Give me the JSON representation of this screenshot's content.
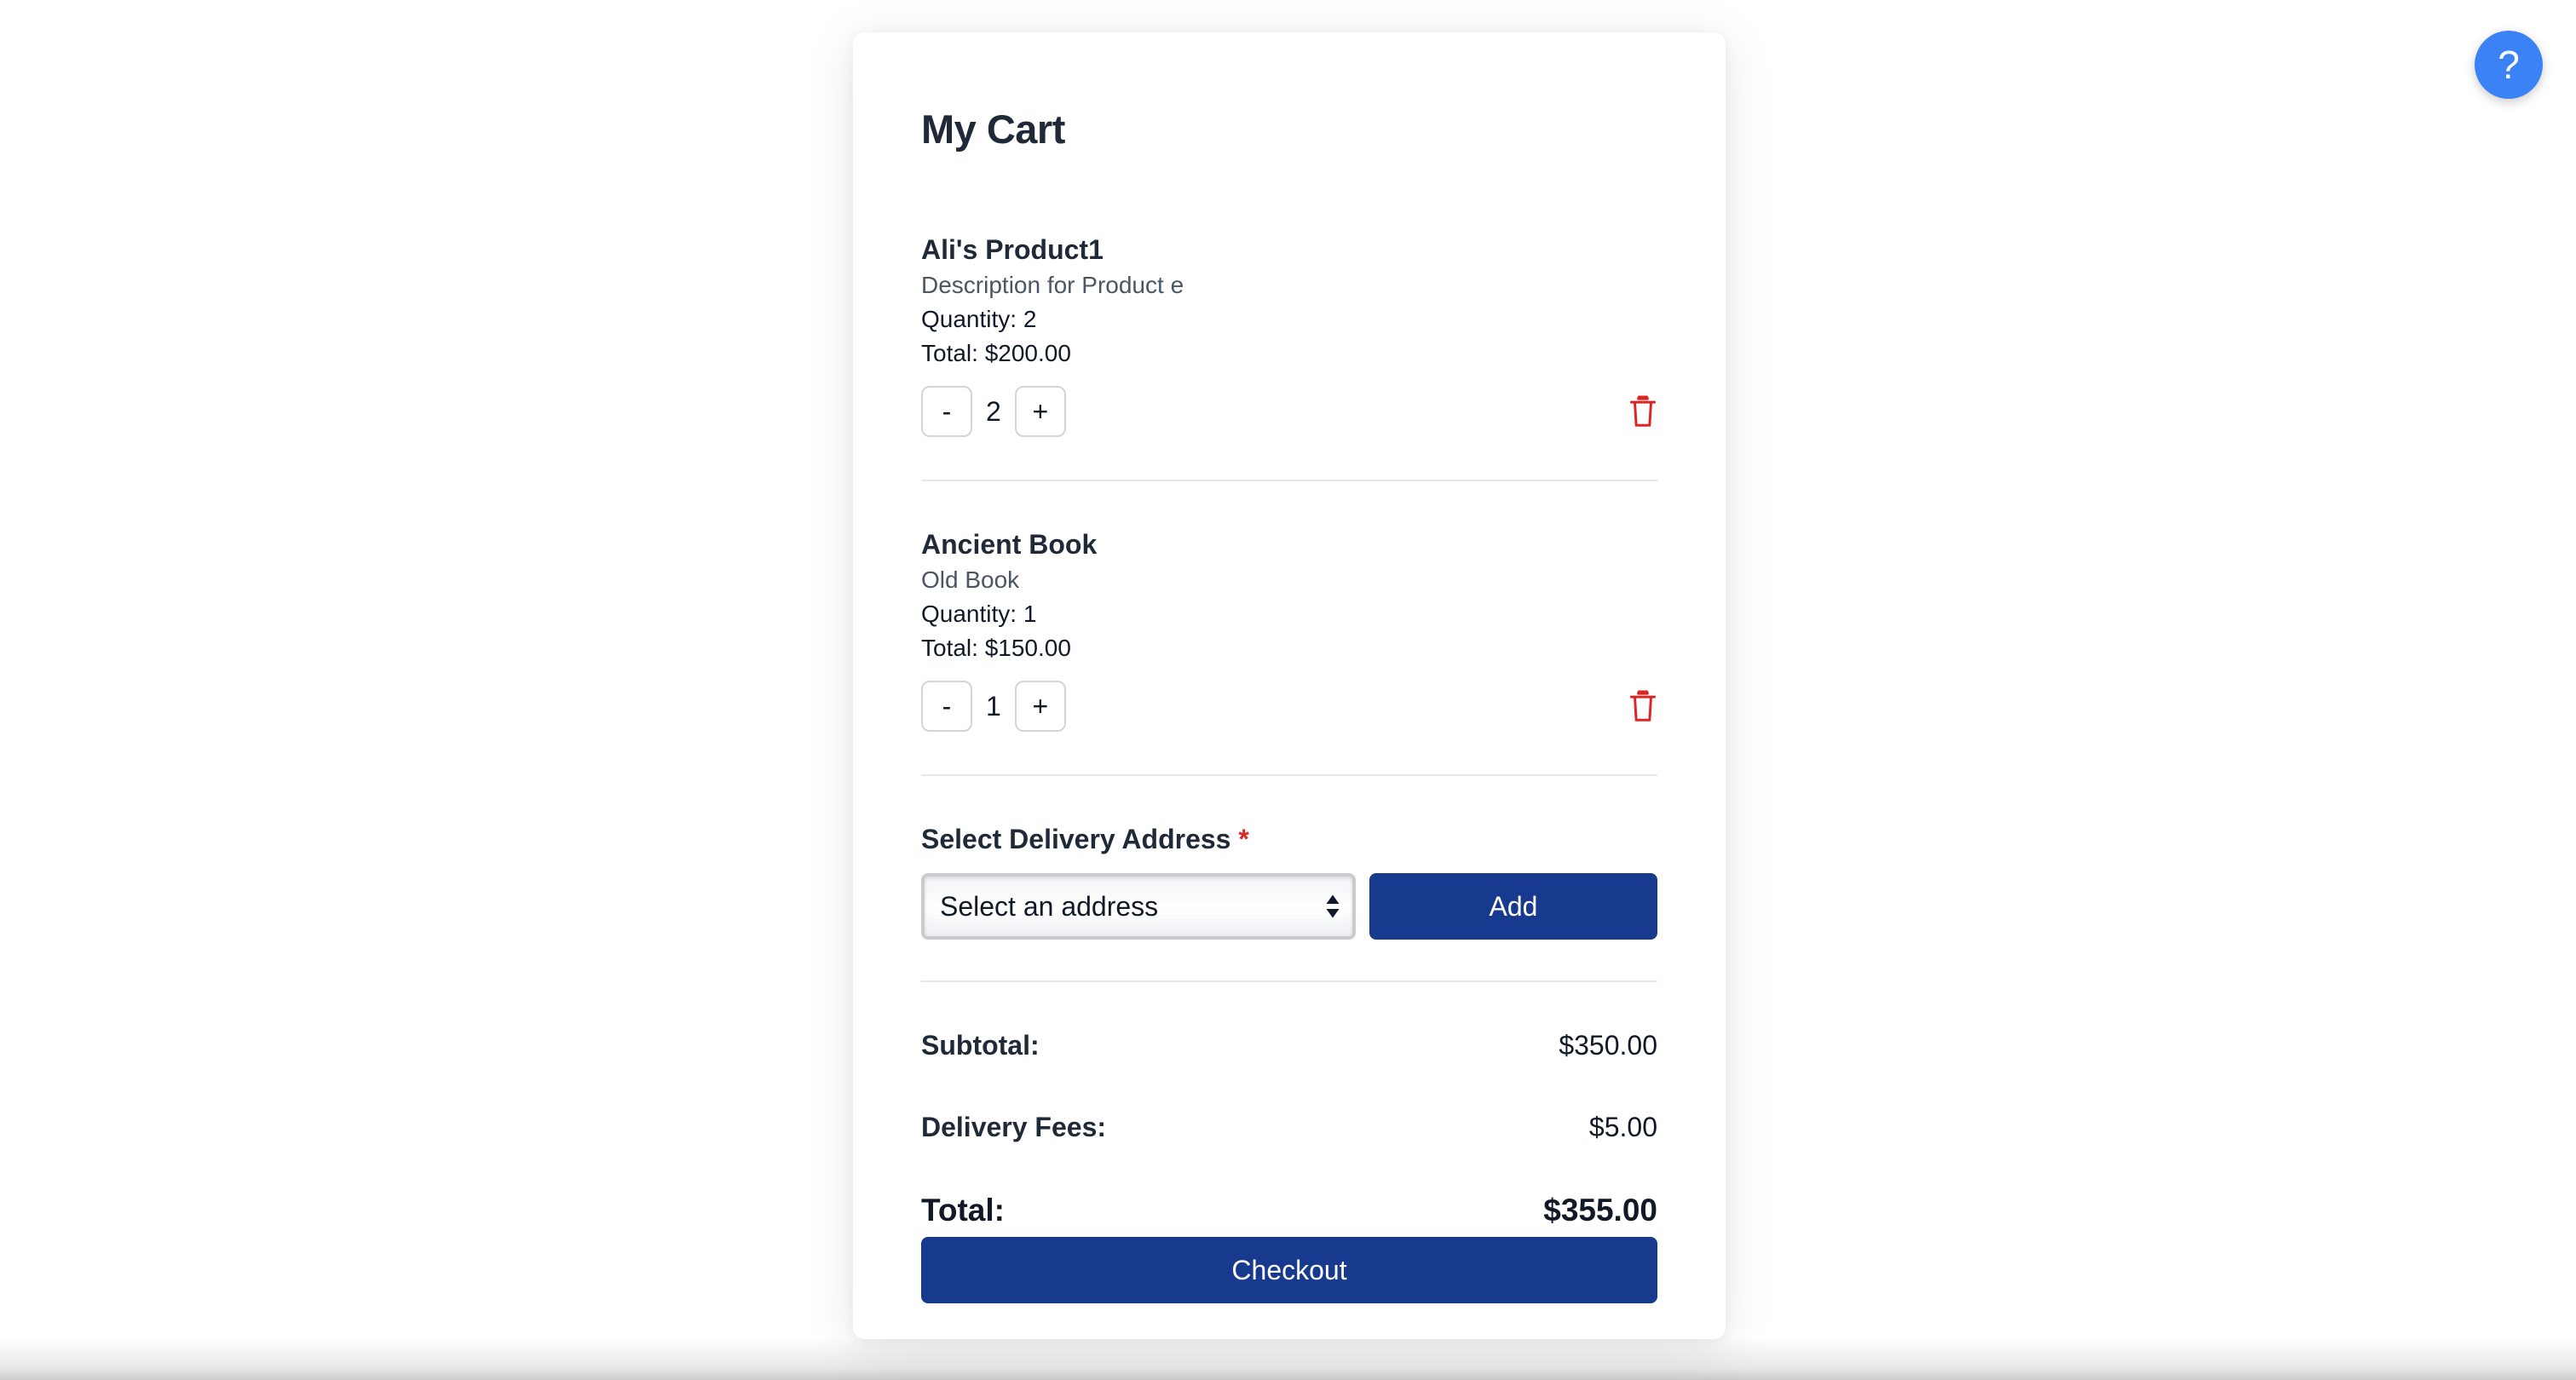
{
  "cart": {
    "title": "My Cart",
    "items": [
      {
        "name": "Ali's Product1",
        "description": "Description for Product e",
        "quantity_text": "Quantity: 2",
        "total_text": "Total: $200.00",
        "stepper_value": "2",
        "minus_label": "-",
        "plus_label": "+"
      },
      {
        "name": "Ancient Book",
        "description": "Old Book",
        "quantity_text": "Quantity: 1",
        "total_text": "Total: $150.00",
        "stepper_value": "1",
        "minus_label": "-",
        "plus_label": "+"
      }
    ],
    "address": {
      "label": "Select Delivery Address",
      "required_mark": "*",
      "select_value": "Select an address",
      "add_label": "Add"
    },
    "summary": {
      "subtotal_label": "Subtotal:",
      "subtotal_value": "$350.00",
      "delivery_label": "Delivery Fees:",
      "delivery_value": "$5.00",
      "total_label": "Total:",
      "total_value": "$355.00"
    },
    "checkout_label": "Checkout"
  },
  "help": {
    "label": "?"
  },
  "colors": {
    "primary_button": "#173a8f",
    "help_button": "#3b82f6",
    "delete_icon": "#dc2626",
    "required_mark": "#dc2626"
  },
  "icons": {
    "delete": "trash-icon",
    "select": "select-arrows-icon"
  }
}
